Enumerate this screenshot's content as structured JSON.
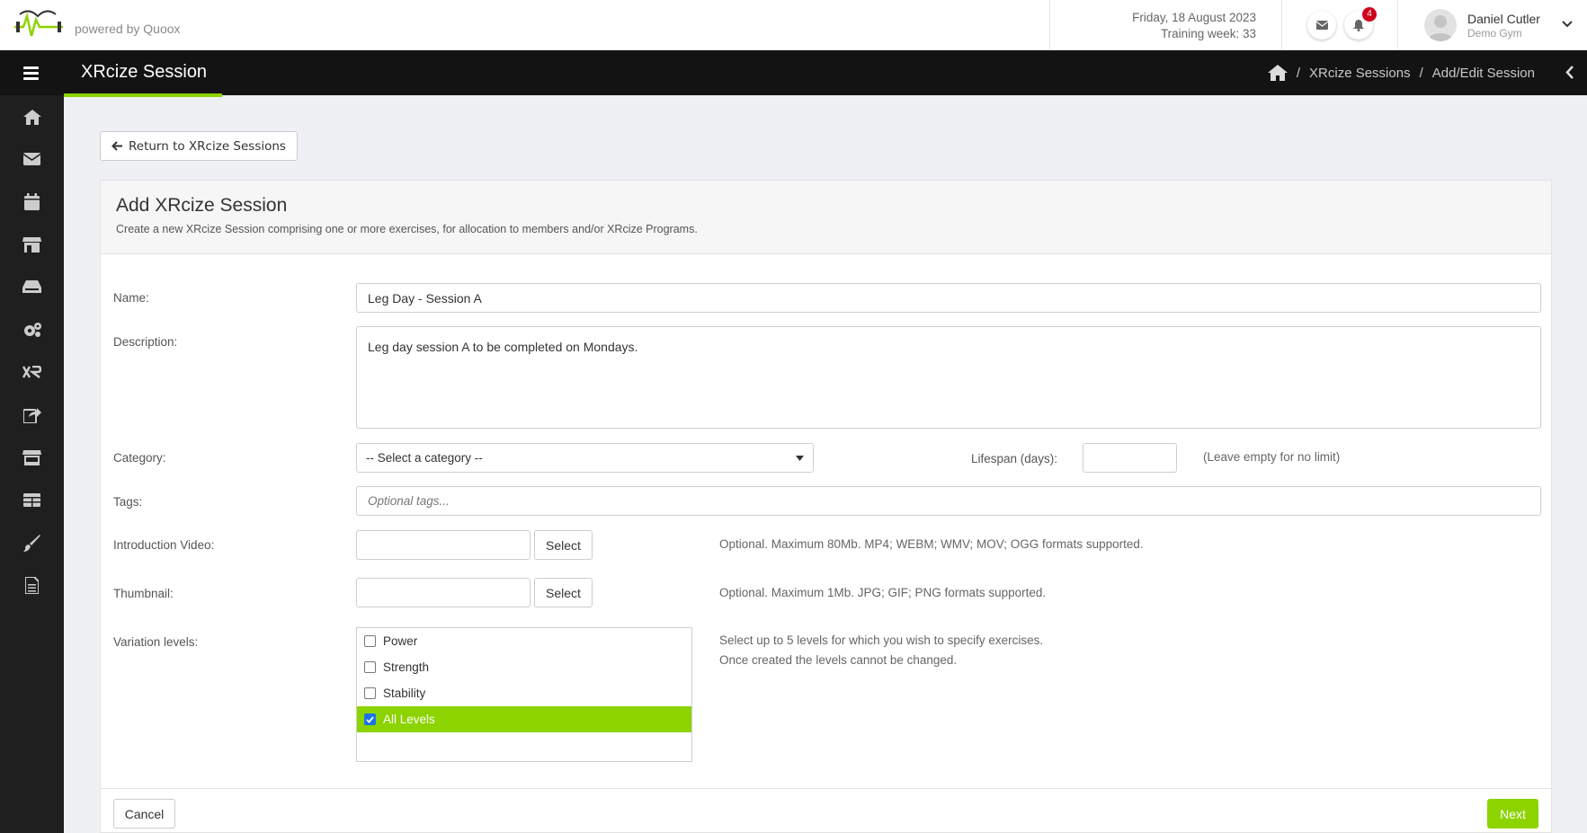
{
  "header": {
    "powered_by": "powered by Quoox",
    "date": "Friday, 18 August 2023",
    "training_week": "Training week: 33",
    "notification_count": "4",
    "user_name": "Daniel Cutler",
    "user_org": "Demo Gym"
  },
  "titlebar": {
    "title": "XRcize Session",
    "breadcrumb": [
      "XRcize Sessions",
      "Add/Edit Session"
    ],
    "separator": "/"
  },
  "sidebar": {
    "icons": [
      "home-icon",
      "mail-icon",
      "calendar-icon",
      "store-icon",
      "inbox-icon",
      "cogs-icon",
      "xr-icon",
      "share-icon",
      "shop-icon",
      "table-icon",
      "brush-icon",
      "document-icon"
    ]
  },
  "main": {
    "return_label": "Return to XRcize Sessions",
    "panel_title": "Add XRcize Session",
    "panel_subtitle": "Create a new XRcize Session comprising one or more exercises, for allocation to members and/or XRcize Programs.",
    "form": {
      "name_label": "Name:",
      "name_value": "Leg Day - Session A",
      "description_label": "Description:",
      "description_value": "Leg day session A to be completed on Mondays.",
      "category_label": "Category:",
      "category_value": "-- Select a category --",
      "lifespan_label": "Lifespan (days):",
      "lifespan_value": "",
      "lifespan_help": "(Leave empty for no limit)",
      "tags_label": "Tags:",
      "tags_placeholder": "Optional tags...",
      "video_label": "Introduction Video:",
      "video_select": "Select",
      "video_help": "Optional. Maximum 80Mb. MP4; WEBM; WMV; MOV; OGG formats supported.",
      "thumb_label": "Thumbnail:",
      "thumb_select": "Select",
      "thumb_help": "Optional. Maximum 1Mb. JPG; GIF; PNG formats supported.",
      "levels_label": "Variation levels:",
      "levels": [
        {
          "label": "Power",
          "checked": false
        },
        {
          "label": "Strength",
          "checked": false
        },
        {
          "label": "Stability",
          "checked": false
        },
        {
          "label": "All Levels",
          "checked": true
        }
      ],
      "levels_help_1": "Select up to 5 levels for which you wish to specify exercises.",
      "levels_help_2": "Once created the levels cannot be changed."
    },
    "cancel_label": "Cancel",
    "next_label": "Next"
  },
  "colors": {
    "accent": "#8cd300",
    "dark": "#131313",
    "sidebar": "#1f1f1f",
    "badge": "#d0021b"
  }
}
